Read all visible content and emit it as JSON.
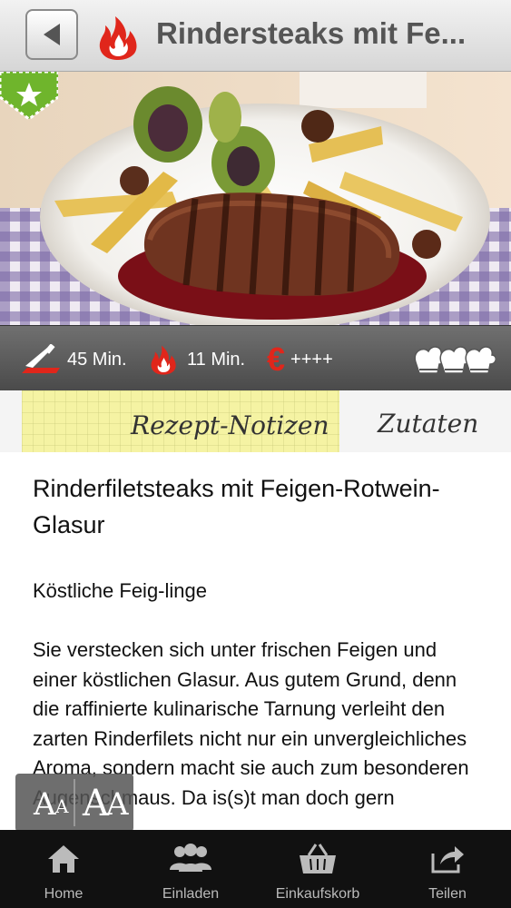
{
  "header": {
    "title": "Rindersteaks mit Fe...",
    "back_icon": "back-arrow-icon",
    "logo_icon": "flame-logo-icon"
  },
  "hero": {
    "image": "steak-with-figs-photo",
    "badge_icon": "star-bookmark-icon"
  },
  "info": {
    "prep_time": "45 Min.",
    "cook_time": "11 Min.",
    "cost": "++++",
    "difficulty_icon": "chef-hats-icon"
  },
  "tabs": {
    "notes": "Rezept-Notizen",
    "ingredients": "Zutaten"
  },
  "recipe": {
    "title": "Rinderfiletsteaks mit Feigen-Rotwein-Glasur",
    "subtitle": "Köstliche Feig-linge",
    "body": "Sie verstecken sich unter frischen Feigen und einer köstlichen Glasur. Aus gutem Grund, denn die raffinierte kulinarische Tarnung verleiht den zarten Rinderfilets nicht nur ein unvergleichliches Aroma, sondern macht sie auch zum besonderen Augenschmaus. Da is(s)t man doch gern"
  },
  "font_button": {
    "small": "A",
    "large": "A",
    "icon": "font-size-icon"
  },
  "tabbar": [
    {
      "label": "Home",
      "icon": "home-icon"
    },
    {
      "label": "Einladen",
      "icon": "people-icon"
    },
    {
      "label": "Einkaufskorb",
      "icon": "basket-icon"
    },
    {
      "label": "Teilen",
      "icon": "share-icon"
    }
  ],
  "colors": {
    "accent": "#e0261b",
    "badge": "#6fb52c",
    "tab_note_bg": "#f5f3a3"
  }
}
